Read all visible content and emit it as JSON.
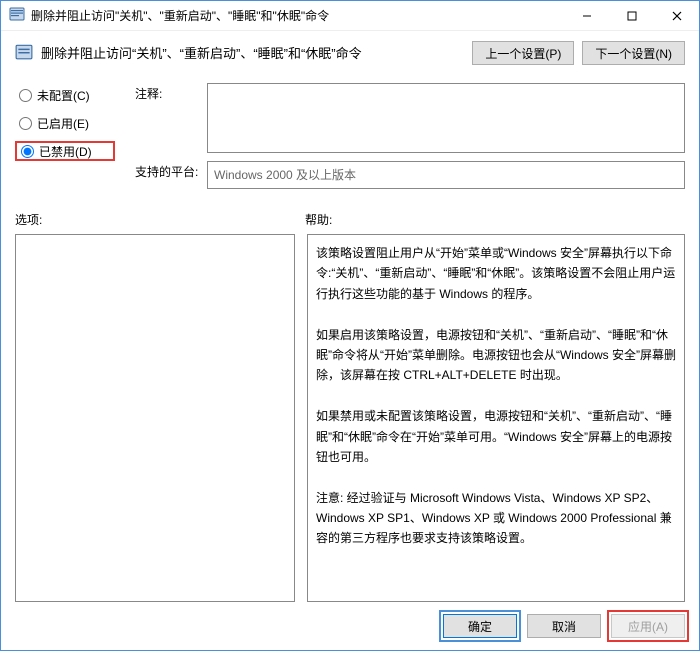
{
  "window": {
    "title": "删除并阻止访问\"关机\"、\"重新启动\"、\"睡眠\"和\"休眠\"命令"
  },
  "header": {
    "title": "删除并阻止访问“关机”、“重新启动”、“睡眠”和“休眠”命令",
    "prev": "上一个设置(P)",
    "next": "下一个设置(N)"
  },
  "radios": {
    "not_configured": "未配置(C)",
    "enabled": "已启用(E)",
    "disabled": "已禁用(D)",
    "selected": "disabled"
  },
  "labels": {
    "comment": "注释:",
    "platform": "支持的平台:",
    "options": "选项:",
    "help": "帮助:"
  },
  "fields": {
    "comment": "",
    "platform": "Windows 2000 及以上版本"
  },
  "help_text": "该策略设置阻止用户从“开始”菜单或“Windows 安全”屏幕执行以下命令:“关机”、“重新启动”、“睡眠”和“休眠”。该策略设置不会阻止用户运行执行这些功能的基于 Windows 的程序。\n\n如果启用该策略设置，电源按钮和“关机”、“重新启动”、“睡眠”和“休眠”命令将从“开始”菜单删除。电源按钮也会从“Windows 安全”屏幕删除，该屏幕在按 CTRL+ALT+DELETE 时出现。\n\n如果禁用或未配置该策略设置，电源按钮和“关机”、“重新启动”、“睡眠”和“休眠”命令在“开始”菜单可用。“Windows 安全”屏幕上的电源按钮也可用。\n\n注意: 经过验证与 Microsoft Windows Vista、Windows XP SP2、Windows XP SP1、Windows XP 或 Windows 2000 Professional 兼容的第三方程序也要求支持该策略设置。",
  "footer": {
    "ok": "确定",
    "cancel": "取消",
    "apply": "应用(A)"
  }
}
